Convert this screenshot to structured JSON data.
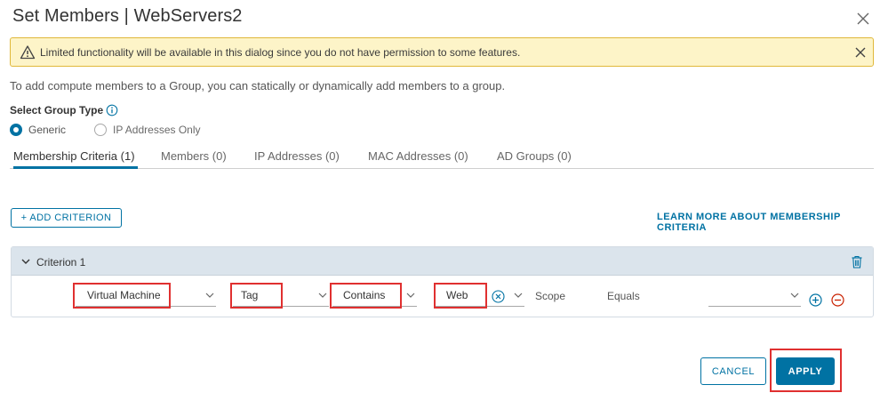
{
  "dialog": {
    "title": "Set Members | WebServers2"
  },
  "warning": {
    "text": "Limited functionality will be available in this dialog since you do not have permission to some features."
  },
  "intro_text": "To add compute members to a Group, you can statically or dynamically add members to a group.",
  "group_type": {
    "label": "Select Group Type",
    "options": [
      {
        "label": "Generic",
        "selected": true
      },
      {
        "label": "IP Addresses Only",
        "selected": false
      }
    ]
  },
  "tabs": [
    {
      "label": "Membership Criteria (1)",
      "active": true
    },
    {
      "label": "Members (0)",
      "active": false
    },
    {
      "label": "IP Addresses (0)",
      "active": false
    },
    {
      "label": "MAC Addresses (0)",
      "active": false
    },
    {
      "label": "AD Groups (0)",
      "active": false
    }
  ],
  "actions": {
    "add_criterion": "+ ADD CRITERION",
    "learn_more": "LEARN MORE ABOUT MEMBERSHIP CRITERIA"
  },
  "criterion": {
    "title": "Criterion 1",
    "member_type": "Virtual Machine",
    "property": "Tag",
    "operator": "Contains",
    "value": "Web",
    "scope_label": "Scope",
    "scope_operator": "Equals",
    "scope_value": ""
  },
  "footer": {
    "cancel": "CANCEL",
    "apply": "APPLY"
  },
  "colors": {
    "accent": "#0072a3",
    "warning_bg": "#fdf4c8",
    "warning_border": "#e0b83a",
    "highlight": "#e03030",
    "remove": "#c92100"
  }
}
